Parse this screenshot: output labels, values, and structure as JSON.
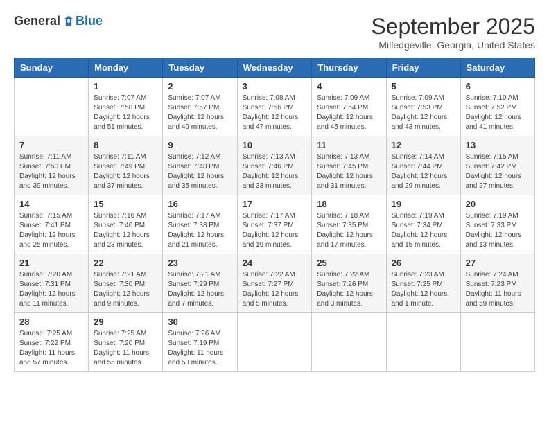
{
  "logo": {
    "general": "General",
    "blue": "Blue"
  },
  "title": "September 2025",
  "location": "Milledgeville, Georgia, United States",
  "headers": [
    "Sunday",
    "Monday",
    "Tuesday",
    "Wednesday",
    "Thursday",
    "Friday",
    "Saturday"
  ],
  "weeks": [
    [
      {
        "day": "",
        "content": ""
      },
      {
        "day": "1",
        "content": "Sunrise: 7:07 AM\nSunset: 7:58 PM\nDaylight: 12 hours\nand 51 minutes."
      },
      {
        "day": "2",
        "content": "Sunrise: 7:07 AM\nSunset: 7:57 PM\nDaylight: 12 hours\nand 49 minutes."
      },
      {
        "day": "3",
        "content": "Sunrise: 7:08 AM\nSunset: 7:56 PM\nDaylight: 12 hours\nand 47 minutes."
      },
      {
        "day": "4",
        "content": "Sunrise: 7:09 AM\nSunset: 7:54 PM\nDaylight: 12 hours\nand 45 minutes."
      },
      {
        "day": "5",
        "content": "Sunrise: 7:09 AM\nSunset: 7:53 PM\nDaylight: 12 hours\nand 43 minutes."
      },
      {
        "day": "6",
        "content": "Sunrise: 7:10 AM\nSunset: 7:52 PM\nDaylight: 12 hours\nand 41 minutes."
      }
    ],
    [
      {
        "day": "7",
        "content": "Sunrise: 7:11 AM\nSunset: 7:50 PM\nDaylight: 12 hours\nand 39 minutes."
      },
      {
        "day": "8",
        "content": "Sunrise: 7:11 AM\nSunset: 7:49 PM\nDaylight: 12 hours\nand 37 minutes."
      },
      {
        "day": "9",
        "content": "Sunrise: 7:12 AM\nSunset: 7:48 PM\nDaylight: 12 hours\nand 35 minutes."
      },
      {
        "day": "10",
        "content": "Sunrise: 7:13 AM\nSunset: 7:46 PM\nDaylight: 12 hours\nand 33 minutes."
      },
      {
        "day": "11",
        "content": "Sunrise: 7:13 AM\nSunset: 7:45 PM\nDaylight: 12 hours\nand 31 minutes."
      },
      {
        "day": "12",
        "content": "Sunrise: 7:14 AM\nSunset: 7:44 PM\nDaylight: 12 hours\nand 29 minutes."
      },
      {
        "day": "13",
        "content": "Sunrise: 7:15 AM\nSunset: 7:42 PM\nDaylight: 12 hours\nand 27 minutes."
      }
    ],
    [
      {
        "day": "14",
        "content": "Sunrise: 7:15 AM\nSunset: 7:41 PM\nDaylight: 12 hours\nand 25 minutes."
      },
      {
        "day": "15",
        "content": "Sunrise: 7:16 AM\nSunset: 7:40 PM\nDaylight: 12 hours\nand 23 minutes."
      },
      {
        "day": "16",
        "content": "Sunrise: 7:17 AM\nSunset: 7:38 PM\nDaylight: 12 hours\nand 21 minutes."
      },
      {
        "day": "17",
        "content": "Sunrise: 7:17 AM\nSunset: 7:37 PM\nDaylight: 12 hours\nand 19 minutes."
      },
      {
        "day": "18",
        "content": "Sunrise: 7:18 AM\nSunset: 7:35 PM\nDaylight: 12 hours\nand 17 minutes."
      },
      {
        "day": "19",
        "content": "Sunrise: 7:19 AM\nSunset: 7:34 PM\nDaylight: 12 hours\nand 15 minutes."
      },
      {
        "day": "20",
        "content": "Sunrise: 7:19 AM\nSunset: 7:33 PM\nDaylight: 12 hours\nand 13 minutes."
      }
    ],
    [
      {
        "day": "21",
        "content": "Sunrise: 7:20 AM\nSunset: 7:31 PM\nDaylight: 12 hours\nand 11 minutes."
      },
      {
        "day": "22",
        "content": "Sunrise: 7:21 AM\nSunset: 7:30 PM\nDaylight: 12 hours\nand 9 minutes."
      },
      {
        "day": "23",
        "content": "Sunrise: 7:21 AM\nSunset: 7:29 PM\nDaylight: 12 hours\nand 7 minutes."
      },
      {
        "day": "24",
        "content": "Sunrise: 7:22 AM\nSunset: 7:27 PM\nDaylight: 12 hours\nand 5 minutes."
      },
      {
        "day": "25",
        "content": "Sunrise: 7:22 AM\nSunset: 7:26 PM\nDaylight: 12 hours\nand 3 minutes."
      },
      {
        "day": "26",
        "content": "Sunrise: 7:23 AM\nSunset: 7:25 PM\nDaylight: 12 hours\nand 1 minute."
      },
      {
        "day": "27",
        "content": "Sunrise: 7:24 AM\nSunset: 7:23 PM\nDaylight: 11 hours\nand 59 minutes."
      }
    ],
    [
      {
        "day": "28",
        "content": "Sunrise: 7:25 AM\nSunset: 7:22 PM\nDaylight: 11 hours\nand 57 minutes."
      },
      {
        "day": "29",
        "content": "Sunrise: 7:25 AM\nSunset: 7:20 PM\nDaylight: 11 hours\nand 55 minutes."
      },
      {
        "day": "30",
        "content": "Sunrise: 7:26 AM\nSunset: 7:19 PM\nDaylight: 11 hours\nand 53 minutes."
      },
      {
        "day": "",
        "content": ""
      },
      {
        "day": "",
        "content": ""
      },
      {
        "day": "",
        "content": ""
      },
      {
        "day": "",
        "content": ""
      }
    ]
  ]
}
